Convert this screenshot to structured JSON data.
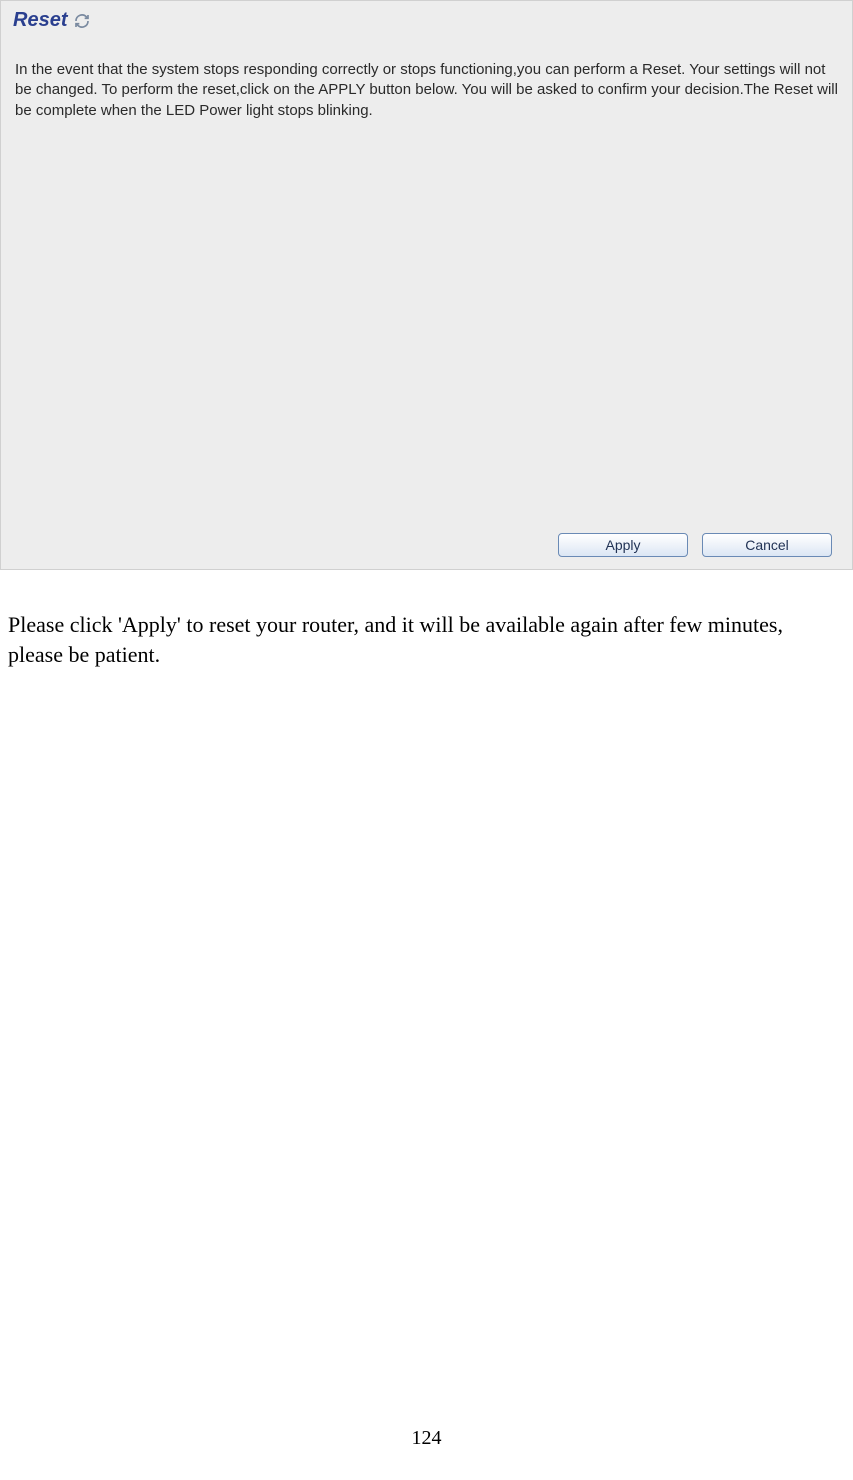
{
  "panel": {
    "title": "Reset",
    "body_text": "In the event that the system stops responding correctly or stops functioning,you can perform a Reset. Your settings will not be changed. To perform the reset,click on the APPLY button below. You will be asked to confirm your decision.The Reset will be complete when the LED Power light stops blinking."
  },
  "buttons": {
    "apply_label": "Apply",
    "cancel_label": "Cancel"
  },
  "instruction": "Please click 'Apply' to reset your router, and it will be available again after few minutes, please be patient.",
  "page_number": "124"
}
